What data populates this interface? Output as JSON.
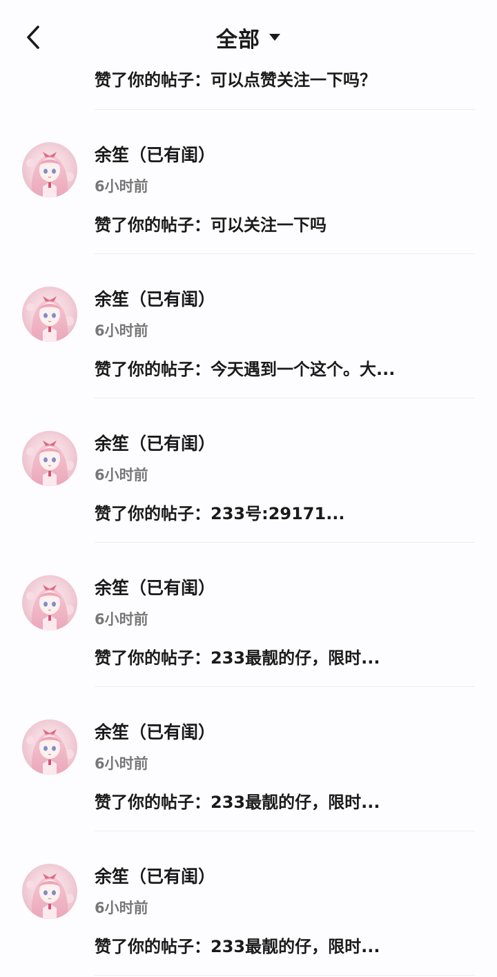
{
  "header": {
    "title": "全部"
  },
  "prev_item": {
    "message": "赞了你的帖子：可以点赞关注一下吗？"
  },
  "items": [
    {
      "name": "余笙（已有闺）",
      "time": "6小时前",
      "message": "赞了你的帖子：可以关注一下吗"
    },
    {
      "name": "余笙（已有闺）",
      "time": "6小时前",
      "message": "赞了你的帖子：今天遇到一个这个。大..."
    },
    {
      "name": "余笙（已有闺）",
      "time": "6小时前",
      "message": "赞了你的帖子：233号:29171..."
    },
    {
      "name": "余笙（已有闺）",
      "time": "6小时前",
      "message": "赞了你的帖子：233最靓的仔，限时..."
    },
    {
      "name": "余笙（已有闺）",
      "time": "6小时前",
      "message": "赞了你的帖子：233最靓的仔，限时..."
    },
    {
      "name": "余笙（已有闺）",
      "time": "6小时前",
      "message": "赞了你的帖子：233最靓的仔，限时..."
    }
  ]
}
